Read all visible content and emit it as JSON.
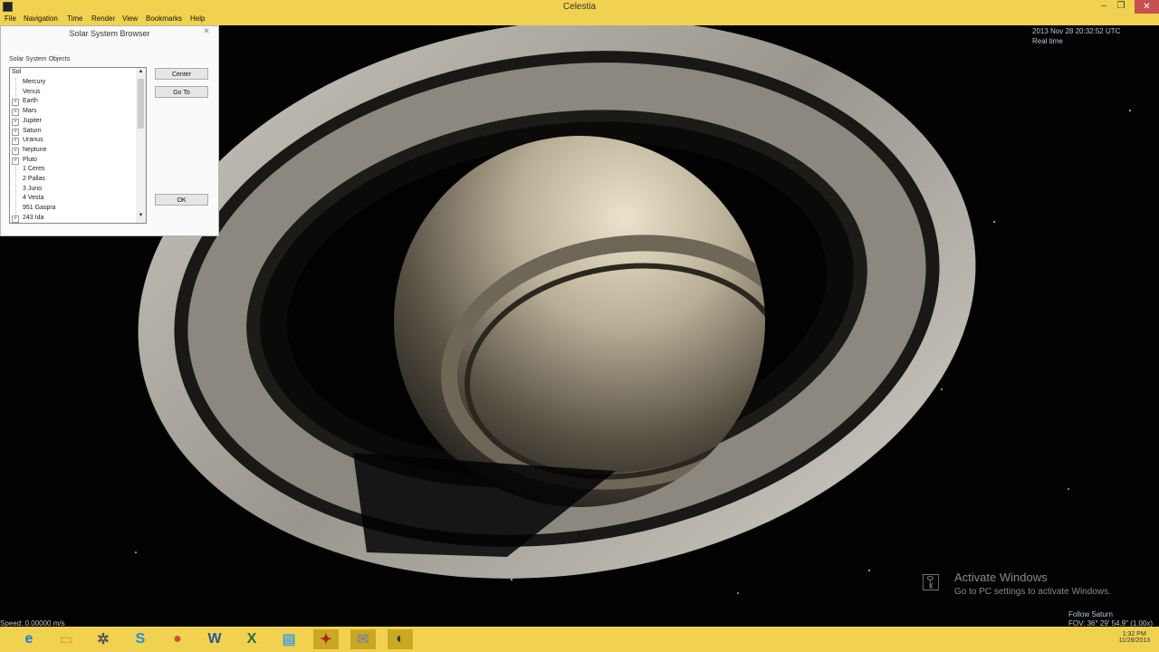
{
  "window": {
    "title": "Celestia"
  },
  "menu": [
    "File",
    "Navigation",
    "Time",
    "Render",
    "View",
    "Bookmarks",
    "Help"
  ],
  "hud": {
    "datetime": "2013 Nov 28 20:32:52 UTC",
    "time_mode": "Real time",
    "speed": "Speed: 0.00000 m/s",
    "follow": "Follow Saturn",
    "fov": "FOV: 36° 29' 54.9\" (1.00x)"
  },
  "dialog": {
    "title": "Solar System Browser",
    "group_label": "Solar System Objects",
    "root": "Sol",
    "items": [
      {
        "label": "Mercury",
        "expandable": false
      },
      {
        "label": "Venus",
        "expandable": false
      },
      {
        "label": "Earth",
        "expandable": true
      },
      {
        "label": "Mars",
        "expandable": true
      },
      {
        "label": "Jupiter",
        "expandable": true
      },
      {
        "label": "Saturn",
        "expandable": true
      },
      {
        "label": "Uranus",
        "expandable": true
      },
      {
        "label": "Neptune",
        "expandable": true
      },
      {
        "label": "Pluto",
        "expandable": true
      },
      {
        "label": "1 Ceres",
        "expandable": false
      },
      {
        "label": "2 Pallas",
        "expandable": false
      },
      {
        "label": "3 Juno",
        "expandable": false
      },
      {
        "label": "4 Vesta",
        "expandable": false
      },
      {
        "label": "951 Gaspra",
        "expandable": false
      },
      {
        "label": "243 Ida",
        "expandable": true
      }
    ],
    "buttons": {
      "center": "Center",
      "goto": "Go To",
      "ok": "OK"
    }
  },
  "watermark": {
    "line1": "Activate Windows",
    "line2": "Go to PC settings to activate Windows."
  },
  "taskbar": {
    "icons": [
      "ie-icon",
      "file-explorer-icon",
      "media-player-icon",
      "skype-icon",
      "chrome-icon",
      "word-icon",
      "excel-icon",
      "notepad-icon",
      "app-red-icon",
      "app-mail-icon",
      "celestia-icon"
    ],
    "time": "1:32 PM",
    "date": "11/28/2013"
  },
  "colors": {
    "chrome": "#f0d250",
    "hud_text": "#b9c7d8"
  }
}
